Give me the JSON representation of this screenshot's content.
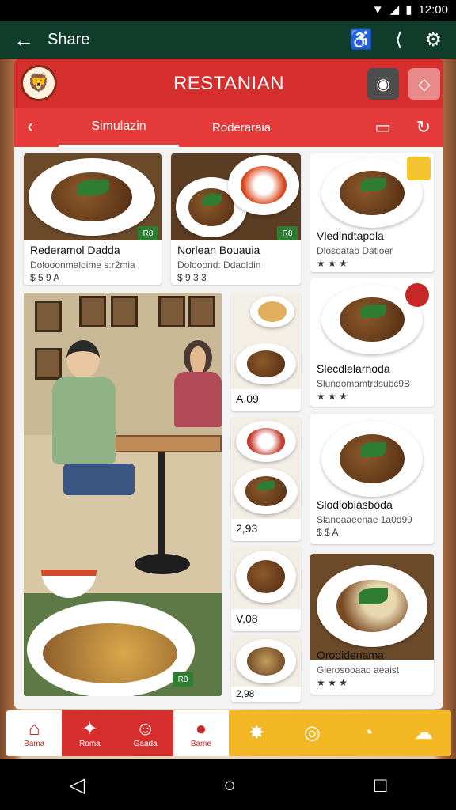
{
  "status_bar": {
    "time": "12:00"
  },
  "appbar": {
    "title": "Share",
    "back_icon": "arrow-left",
    "icons": [
      "accessibility-icon",
      "share-icon",
      "settings-icon"
    ]
  },
  "header": {
    "brand": "RESTANIAN",
    "logo": "lion-face"
  },
  "tabs": {
    "active": "Simulazin",
    "second": "Roderaraia"
  },
  "colors": {
    "primary": "#d62d2d",
    "appbar": "#0f3c2b",
    "accent": "#f4b724",
    "stars": "#c62828"
  },
  "tiles_top": [
    {
      "name": "Rederamol Dadda",
      "sub": "Dolooonmaloime s:r2mia",
      "price": "$ 5 9 A",
      "chip": "R8"
    },
    {
      "name": "Norlean Bouauia",
      "sub": "Dolooond: Ddaoldin",
      "price": "$ 9 3 3",
      "chip": "R8"
    }
  ],
  "tiles_right": [
    {
      "name": "Vledindtapola",
      "sub": "Dlosoatao Datioer",
      "rating": "★ ★ ★"
    },
    {
      "name": "Slecdlelarnoda",
      "sub": "Slundomamtrdsubc9B",
      "rating": "★ ★ ★"
    },
    {
      "name": "Slodlobiasboda",
      "sub": "Slanoaaeenae 1a0d99",
      "rating": "$ $ A"
    },
    {
      "name": "Orodidenama",
      "sub": "Glerosooaao aeaist",
      "rating": "★ ★ ★"
    }
  ],
  "thumbs": [
    {
      "value": "A,09"
    },
    {
      "value": "2,93"
    },
    {
      "value": "V,08"
    },
    {
      "value": "2,98"
    }
  ],
  "bottom_nav": [
    {
      "label": "Bama",
      "icon": "house-icon"
    },
    {
      "label": "Roma",
      "icon": "star-icon"
    },
    {
      "label": "Gaada",
      "icon": "face-icon"
    },
    {
      "label": "Bame",
      "icon": "apple-icon"
    },
    {
      "label": "",
      "icon": "burst-icon"
    },
    {
      "label": "",
      "icon": "compass-icon"
    },
    {
      "label": "",
      "icon": "pie-icon"
    },
    {
      "label": "",
      "icon": "cloud-icon"
    }
  ]
}
